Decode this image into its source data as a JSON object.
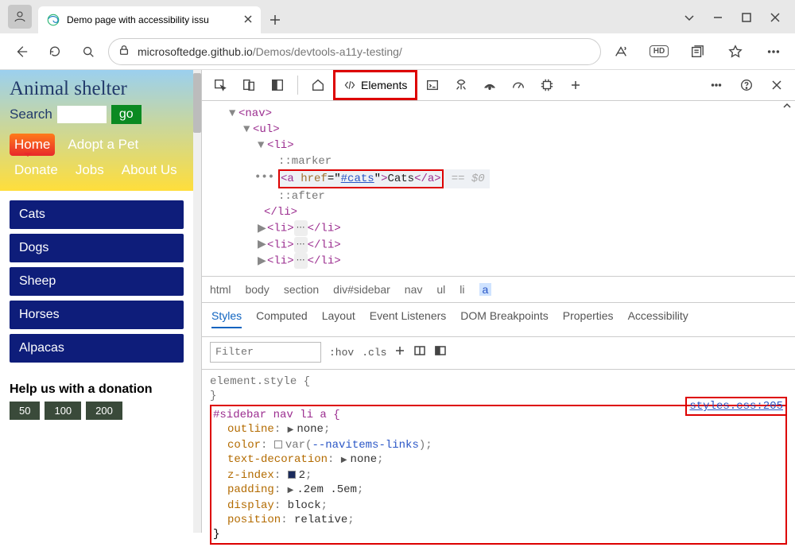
{
  "tab": {
    "title": "Demo page with accessibility issu"
  },
  "address": {
    "host": "microsoftedge.github.io",
    "path": "/Demos/devtools-a11y-testing/"
  },
  "hd_label": "HD",
  "page": {
    "title": "Animal shelter",
    "search_label": "Search",
    "go_label": "go",
    "nav": [
      "Home",
      "Adopt a Pet",
      "Donate",
      "Jobs",
      "About Us"
    ],
    "sidebar": [
      "Cats",
      "Dogs",
      "Sheep",
      "Horses",
      "Alpacas"
    ],
    "help_title": "Help us with a donation",
    "amounts": [
      "50",
      "100",
      "200"
    ]
  },
  "devtools": {
    "elements_label": "Elements",
    "dom": {
      "href": "#cats",
      "link_text": "Cats",
      "eq0": "== $0"
    },
    "crumbs": [
      "html",
      "body",
      "section",
      "div#sidebar",
      "nav",
      "ul",
      "li",
      "a"
    ],
    "styles_tabs": [
      "Styles",
      "Computed",
      "Layout",
      "Event Listeners",
      "DOM Breakpoints",
      "Properties",
      "Accessibility"
    ],
    "filter_placeholder": "Filter",
    "hov": ":hov",
    "cls": ".cls",
    "element_style": "element.style {",
    "rule": {
      "selector": "#sidebar nav li a {",
      "decls": [
        {
          "n": "outline",
          "v": "none",
          "tri": true
        },
        {
          "n": "color",
          "v": "var(--navitems-links)",
          "swatch": "light",
          "var": true
        },
        {
          "n": "text-decoration",
          "v": "none",
          "tri": true
        },
        {
          "n": "z-index",
          "v": "2",
          "swatch": "dark"
        },
        {
          "n": "padding",
          "v": ".2em .5em",
          "tri": true
        },
        {
          "n": "display",
          "v": "block"
        },
        {
          "n": "position",
          "v": "relative"
        }
      ],
      "source": "styles.css:205"
    }
  }
}
